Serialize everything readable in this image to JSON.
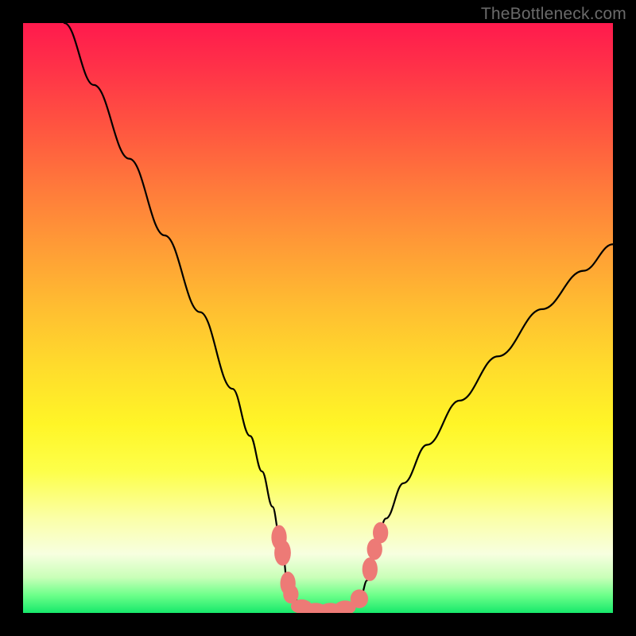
{
  "watermark": "TheBottleneck.com",
  "chart_data": {
    "type": "line",
    "title": "",
    "xlabel": "",
    "ylabel": "",
    "xlim": [
      0,
      100
    ],
    "ylim": [
      0,
      100
    ],
    "annotations": [],
    "series": [
      {
        "name": "curve",
        "x": [
          7.0,
          12.0,
          18.0,
          24.0,
          30.0,
          35.5,
          38.5,
          40.5,
          42.3,
          43.5,
          44.2,
          44.7,
          45.8,
          47.5,
          49.8,
          52.2,
          55.0,
          57.3,
          58.3,
          59.0,
          59.8,
          61.5,
          64.5,
          68.5,
          74.0,
          80.5,
          88.0,
          95.0,
          100.0
        ],
        "y": [
          100.0,
          89.5,
          77.0,
          64.0,
          51.0,
          38.0,
          30.0,
          24.0,
          18.0,
          13.0,
          9.0,
          5.5,
          2.5,
          1.0,
          0.3,
          0.3,
          1.0,
          3.0,
          5.5,
          8.5,
          11.5,
          16.0,
          22.0,
          28.5,
          36.0,
          43.5,
          51.5,
          58.0,
          62.5
        ]
      }
    ],
    "markers": [
      {
        "x": 43.4,
        "y": 12.8,
        "rx": 1.3,
        "ry": 2.1
      },
      {
        "x": 44.0,
        "y": 10.2,
        "rx": 1.4,
        "ry": 2.2
      },
      {
        "x": 44.9,
        "y": 5.0,
        "rx": 1.3,
        "ry": 2.0
      },
      {
        "x": 45.4,
        "y": 3.2,
        "rx": 1.3,
        "ry": 1.6
      },
      {
        "x": 47.2,
        "y": 1.1,
        "rx": 1.8,
        "ry": 1.2
      },
      {
        "x": 49.6,
        "y": 0.5,
        "rx": 2.0,
        "ry": 1.2
      },
      {
        "x": 52.1,
        "y": 0.5,
        "rx": 2.0,
        "ry": 1.2
      },
      {
        "x": 54.6,
        "y": 0.9,
        "rx": 1.8,
        "ry": 1.2
      },
      {
        "x": 57.0,
        "y": 2.4,
        "rx": 1.5,
        "ry": 1.6
      },
      {
        "x": 58.8,
        "y": 7.4,
        "rx": 1.3,
        "ry": 2.0
      },
      {
        "x": 59.6,
        "y": 10.8,
        "rx": 1.3,
        "ry": 1.8
      },
      {
        "x": 60.6,
        "y": 13.6,
        "rx": 1.3,
        "ry": 1.8
      }
    ],
    "marker_color": "#ed7a76",
    "curve_color": "#000000",
    "background_gradient": {
      "top": "#ff1a4d",
      "mid": "#ffdb2c",
      "bottom": "#17e86b"
    }
  }
}
